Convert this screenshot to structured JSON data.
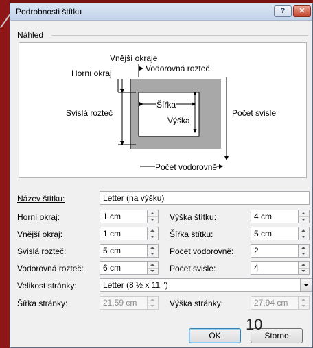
{
  "dialog": {
    "title": "Podrobnosti štítku",
    "help_symbol": "?",
    "close_symbol": "✕"
  },
  "preview": {
    "group_label": "Náhled",
    "labels": {
      "outer_margin": "Vnější okraje",
      "top_margin": "Horní okraj",
      "horizontal_pitch": "Vodorovná rozteč",
      "vertical_pitch": "Svislá rozteč",
      "width": "Šířka",
      "height": "Výška",
      "count_vertical": "Počet svisle",
      "count_horizontal": "Počet vodorovně"
    }
  },
  "form": {
    "label_name": {
      "label": "Název štítku:",
      "value": "Letter (na výšku)"
    },
    "top_margin": {
      "label": "Horní okraj:",
      "value": "1 cm"
    },
    "label_height": {
      "label": "Výška štítku:",
      "value": "4 cm"
    },
    "side_margin": {
      "label": "Vnější okraj:",
      "value": "1 cm"
    },
    "label_width": {
      "label": "Šířka štítku:",
      "value": "5 cm"
    },
    "vertical_pitch": {
      "label": "Svislá rozteč:",
      "value": "5 cm"
    },
    "count_across": {
      "label": "Počet vodorovně:",
      "value": "2"
    },
    "horizontal_pitch": {
      "label": "Vodorovná rozteč:",
      "value": "6 cm"
    },
    "count_down": {
      "label": "Počet svisle:",
      "value": "4"
    },
    "page_size": {
      "label": "Velikost stránky:",
      "value": "Letter (8 ½ x 11 \")"
    },
    "page_width": {
      "label": "Šířka stránky:",
      "value": "21,59 cm"
    },
    "page_height": {
      "label": "Výška stránky:",
      "value": "27,94 cm"
    }
  },
  "buttons": {
    "ok": "OK",
    "cancel": "Storno"
  },
  "overlay_number": "10"
}
